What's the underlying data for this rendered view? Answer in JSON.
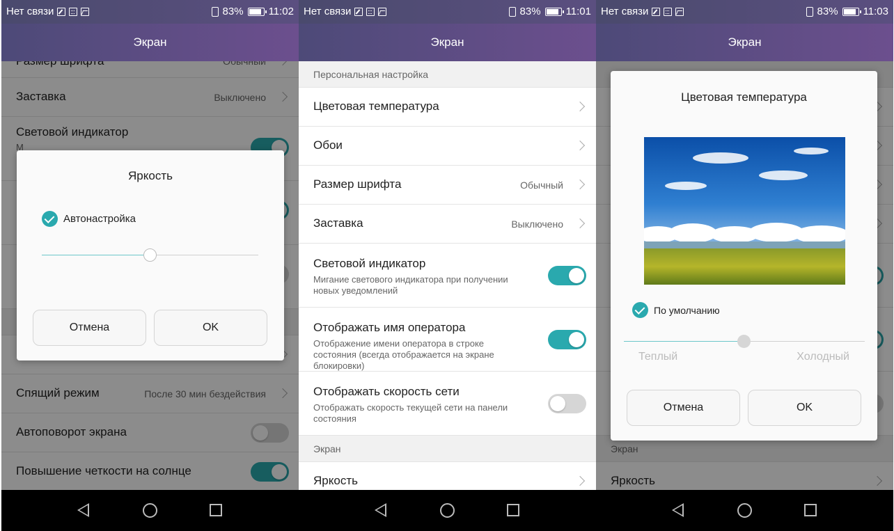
{
  "screens": [
    {
      "status": {
        "carrier": "Нет связи",
        "battery": "83%",
        "time": "11:02"
      },
      "title": "Экран",
      "rows": [
        {
          "title": "Размер шрифта",
          "value": "Обычный",
          "chevron": true
        },
        {
          "title": "Заставка",
          "value": "Выключено",
          "chevron": true
        },
        {
          "title": "Световой индикатор",
          "sub": "М",
          "toggle": "on"
        },
        {
          "title": "Спящий режим",
          "value": "После 30 мин бездействия",
          "chevron": true
        },
        {
          "title": "Автоповорот экрана",
          "toggle": "off"
        },
        {
          "title": "Повышение четкости на солнце",
          "toggle": "on"
        }
      ],
      "dialog": {
        "title": "Яркость",
        "checkbox_label": "Автонастройка",
        "checkbox_checked": true,
        "slider_value": 0.5,
        "cancel": "Отмена",
        "ok": "OK"
      }
    },
    {
      "status": {
        "carrier": "Нет связи",
        "battery": "83%",
        "time": "11:01"
      },
      "title": "Экран",
      "section1": "Персональная настройка",
      "rows": [
        {
          "title": "Цветовая температура",
          "chevron": true
        },
        {
          "title": "Обои",
          "chevron": true
        },
        {
          "title": "Размер шрифта",
          "value": "Обычный",
          "chevron": true
        },
        {
          "title": "Заставка",
          "value": "Выключено",
          "chevron": true
        },
        {
          "title": "Световой индикатор",
          "sub": "Мигание светового индикатора при получении новых уведомлений",
          "toggle": "on"
        },
        {
          "title": "Отображать имя оператора",
          "sub": "Отображение имени оператора в строке состояния (всегда отображается на экране блокировки)",
          "toggle": "on"
        },
        {
          "title": "Отображать скорость сети",
          "sub": "Отображать скорость текущей сети на панели состояния",
          "toggle": "off"
        }
      ],
      "section2": "Экран",
      "rows2": [
        {
          "title": "Яркость",
          "chevron": true
        }
      ]
    },
    {
      "status": {
        "carrier": "Нет связи",
        "battery": "83%",
        "time": "11:03"
      },
      "title": "Экран",
      "bg_section": "Экран",
      "bg_row": "Яркость",
      "dialog": {
        "title": "Цветовая температура",
        "checkbox_label": "По умолчанию",
        "checkbox_checked": true,
        "slider_value": 0.5,
        "warm": "Теплый",
        "cold": "Холодный",
        "cancel": "Отмена",
        "ok": "OK"
      }
    }
  ],
  "colors": {
    "accent": "#2aa9ae",
    "titlebar": "#5b4f80",
    "nav_bg": "#000000"
  },
  "icons": [
    "edit-icon",
    "keyboard-icon",
    "image-icon",
    "sim-icon",
    "battery-icon",
    "back-icon",
    "home-icon",
    "recent-apps-icon",
    "chevron-right-icon",
    "check-icon"
  ]
}
